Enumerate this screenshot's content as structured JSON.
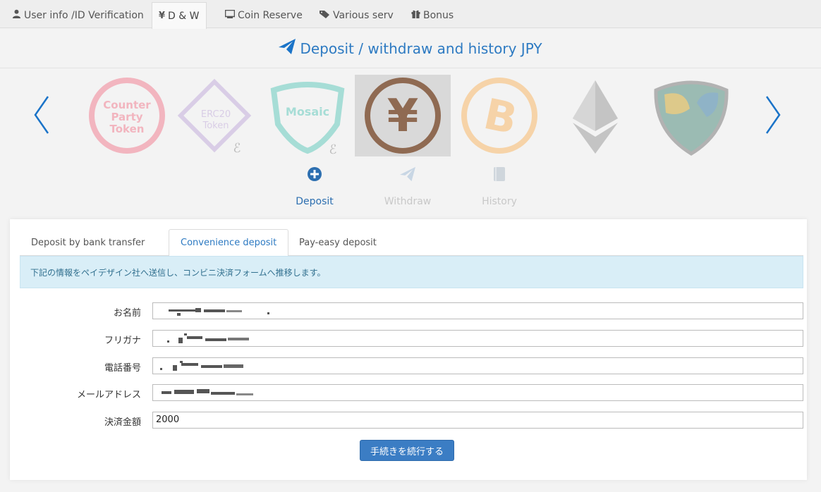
{
  "topnav": {
    "tabs": [
      {
        "label": "User info /ID Verification",
        "icon": "user-icon"
      },
      {
        "label": "D & W",
        "icon": "yen-icon"
      },
      {
        "label": "Coin Reserve",
        "icon": "monitor-icon"
      },
      {
        "label": "Various serv",
        "icon": "tag-icon"
      },
      {
        "label": "Bonus",
        "icon": "gift-icon"
      }
    ]
  },
  "header": {
    "title": "Deposit / withdraw and history JPY"
  },
  "carousel": {
    "coins": [
      {
        "name": "counterparty",
        "line1": "Counter",
        "line2": "Party",
        "line3": "Token"
      },
      {
        "name": "erc20",
        "line1": "ERC20",
        "line2": "Token"
      },
      {
        "name": "mosaic",
        "line1": "Mosaic"
      },
      {
        "name": "jpy",
        "symbol": "¥"
      },
      {
        "name": "bitcoin",
        "symbol": "B"
      },
      {
        "name": "ethereum"
      },
      {
        "name": "nem"
      }
    ]
  },
  "actions": {
    "deposit": "Deposit",
    "withdraw": "Withdraw",
    "history": "History"
  },
  "subtabs": [
    "Deposit by bank transfer",
    "Convenience deposit",
    "Pay-easy deposit"
  ],
  "notice": "下記の情報をペイデザイン社へ送信し、コンビニ決済フォームへ推移します。",
  "form": {
    "name_label": "お名前",
    "kana_label": "フリガナ",
    "phone_label": "電話番号",
    "email_label": "メールアドレス",
    "amount_label": "決済金額",
    "amount_value": "2000"
  },
  "submit_label": "手続きを続行する",
  "colors": {
    "accent": "#2d7ac2",
    "button": "#3b7dc4",
    "notice_bg": "#d9eef7"
  }
}
